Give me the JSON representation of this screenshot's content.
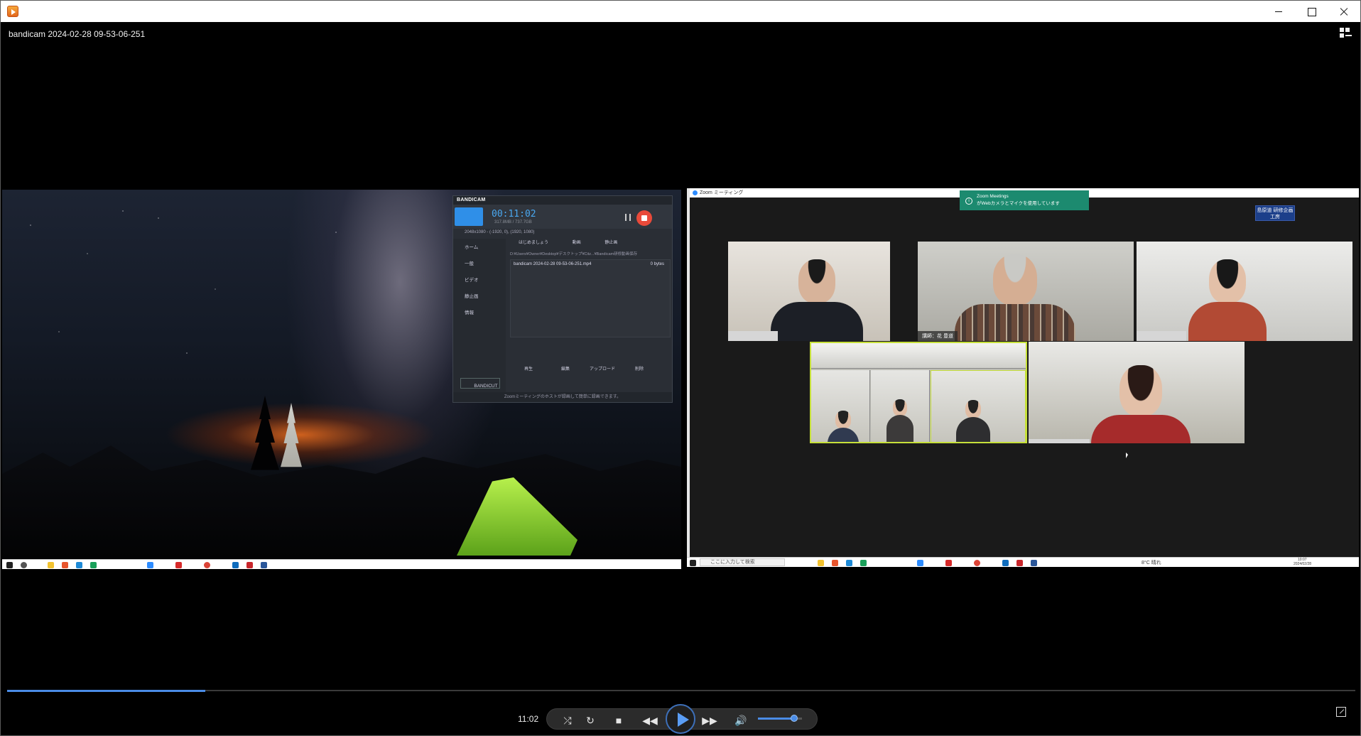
{
  "window": {
    "title": "bandicam 2024-02-28 09-53-06-251"
  },
  "bandicam": {
    "logo": "BANDICAM",
    "timer": "00:11:02",
    "size": "317.8MB / 737.7GB",
    "resolution": "2048x1080 - (-1920, 0), (1920, 1080)",
    "sidebar": [
      "ホーム",
      "一般",
      "ビデオ",
      "静止画",
      "情報"
    ],
    "tabs": [
      "はじめましょう",
      "動画",
      "静止画"
    ],
    "path": "D:¥Users¥Owner¥Desktop¥デスクトップ¥Citz...¥Bandicam研修動画保存",
    "file_name": "bandicam 2024-02-28 09-53-06-251.mp4",
    "file_size": "0 bytes",
    "actions": [
      "再生",
      "編集",
      "アップロード",
      "削除"
    ],
    "cut_label": "BANDICUT",
    "footer": "Zoomミーティングのホストが録画して簡単に録画できます。"
  },
  "zoom": {
    "title": "Zoom ミーティング",
    "toast_line1": "Zoom Meetings",
    "toast_line2": "がWebカメラとマイクを使用しています",
    "tag": "島原道 研修企画工房",
    "tile_names": [
      "",
      "講師：花 豊道",
      "",
      "",
      ""
    ]
  },
  "taskbar": {
    "search_placeholder": "ここに入力して検索",
    "weather": "8°C 晴れ",
    "clock_time": "10:07",
    "clock_date": "2024/02/28"
  },
  "player": {
    "current_time": "11:02",
    "progress_fraction": 0.147,
    "volume_fraction": 0.82
  }
}
